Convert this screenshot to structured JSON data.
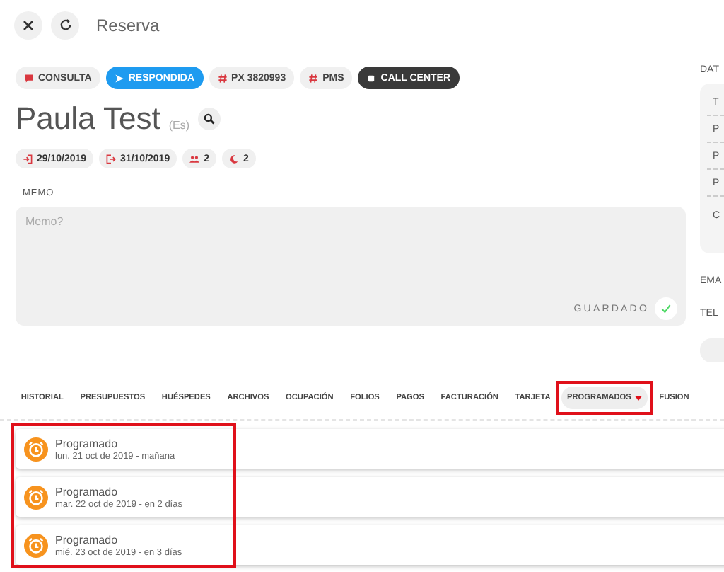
{
  "header": {
    "title": "Reserva"
  },
  "badges": [
    {
      "kind": "inquiry",
      "label": "CONSULTA"
    },
    {
      "kind": "answered",
      "label": "RESPONDIDA"
    },
    {
      "kind": "tag",
      "label": "PX 3820993"
    },
    {
      "kind": "tag",
      "label": "PMS"
    },
    {
      "kind": "channel",
      "label": "CALL CENTER"
    }
  ],
  "guest": {
    "name": "Paula Test",
    "language": "(Es)"
  },
  "stay_chips": [
    {
      "kind": "checkin",
      "label": "29/10/2019"
    },
    {
      "kind": "checkout",
      "label": "31/10/2019"
    },
    {
      "kind": "guests",
      "label": "2"
    },
    {
      "kind": "nights",
      "label": "2"
    }
  ],
  "memo": {
    "label": "MEMO",
    "placeholder": "Memo?",
    "status": "GUARDADO"
  },
  "side_panel": {
    "heading": "DAT",
    "rows": [
      "T",
      "P",
      "P",
      "P",
      "C"
    ],
    "fields": [
      "EMA",
      "TEL"
    ]
  },
  "tabs": [
    {
      "label": "HISTORIAL",
      "selected": false,
      "dropdown": false,
      "highlighted": false
    },
    {
      "label": "PRESUPUESTOS",
      "selected": false,
      "dropdown": false,
      "highlighted": false
    },
    {
      "label": "HUÉSPEDES",
      "selected": false,
      "dropdown": false,
      "highlighted": false
    },
    {
      "label": "ARCHIVOS",
      "selected": false,
      "dropdown": false,
      "highlighted": false
    },
    {
      "label": "OCUPACIÓN",
      "selected": false,
      "dropdown": false,
      "highlighted": false
    },
    {
      "label": "FOLIOS",
      "selected": false,
      "dropdown": false,
      "highlighted": false
    },
    {
      "label": "PAGOS",
      "selected": false,
      "dropdown": false,
      "highlighted": false
    },
    {
      "label": "FACTURACIÓN",
      "selected": false,
      "dropdown": false,
      "highlighted": false
    },
    {
      "label": "TARJETA",
      "selected": false,
      "dropdown": false,
      "highlighted": false
    },
    {
      "label": "PROGRAMADOS",
      "selected": true,
      "dropdown": true,
      "highlighted": true
    },
    {
      "label": "FUSION",
      "selected": false,
      "dropdown": false,
      "highlighted": false
    }
  ],
  "scheduled": {
    "highlighted": true,
    "items": [
      {
        "title": "Programado",
        "subtitle": "lun. 21 oct de 2019 - mañana"
      },
      {
        "title": "Programado",
        "subtitle": "mar. 22 oct de 2019 - en 2 días"
      },
      {
        "title": "Programado",
        "subtitle": "mié. 23 oct de 2019 - en 3 días"
      }
    ]
  }
}
